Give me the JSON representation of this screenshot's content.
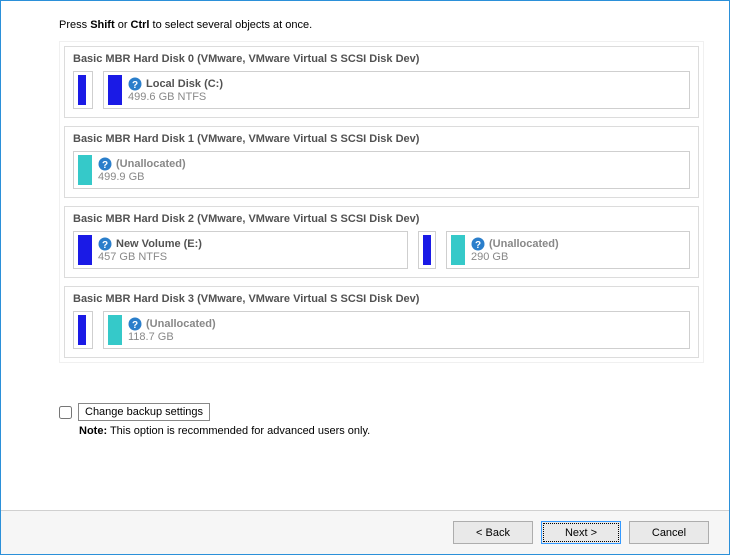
{
  "instruction": {
    "pre": "Press ",
    "k1": "Shift",
    "mid": " or ",
    "k2": "Ctrl",
    "post": " to select several objects at once."
  },
  "disks": [
    {
      "title": "Basic MBR Hard Disk 0 (VMware, VMware Virtual S SCSI Disk Dev)"
    },
    {
      "title": "Basic MBR Hard Disk 1 (VMware, VMware Virtual S SCSI Disk Dev)"
    },
    {
      "title": "Basic MBR Hard Disk 2 (VMware, VMware Virtual S SCSI Disk Dev)"
    },
    {
      "title": "Basic MBR Hard Disk 3 (VMware, VMware Virtual S SCSI Disk Dev)"
    }
  ],
  "d0_reserved_name": "",
  "d0_vol0": {
    "name": "Local Disk (C:)",
    "sub": "499.6 GB NTFS"
  },
  "d1_vol0": {
    "name": "(Unallocated)",
    "sub": "499.9 GB"
  },
  "d2_vol0": {
    "name": "New Volume (E:)",
    "sub": "457 GB NTFS"
  },
  "d2_vol1": {
    "name": "(Unallocated)",
    "sub": "290 GB"
  },
  "d3_vol0": {
    "name": "(Unallocated)",
    "sub": "118.7 GB"
  },
  "settings_label": "Change backup settings",
  "note_label": "Note:",
  "note_text": " This option is recommended for advanced users only.",
  "buttons": {
    "back": "< Back",
    "next": "Next >",
    "cancel": "Cancel"
  }
}
